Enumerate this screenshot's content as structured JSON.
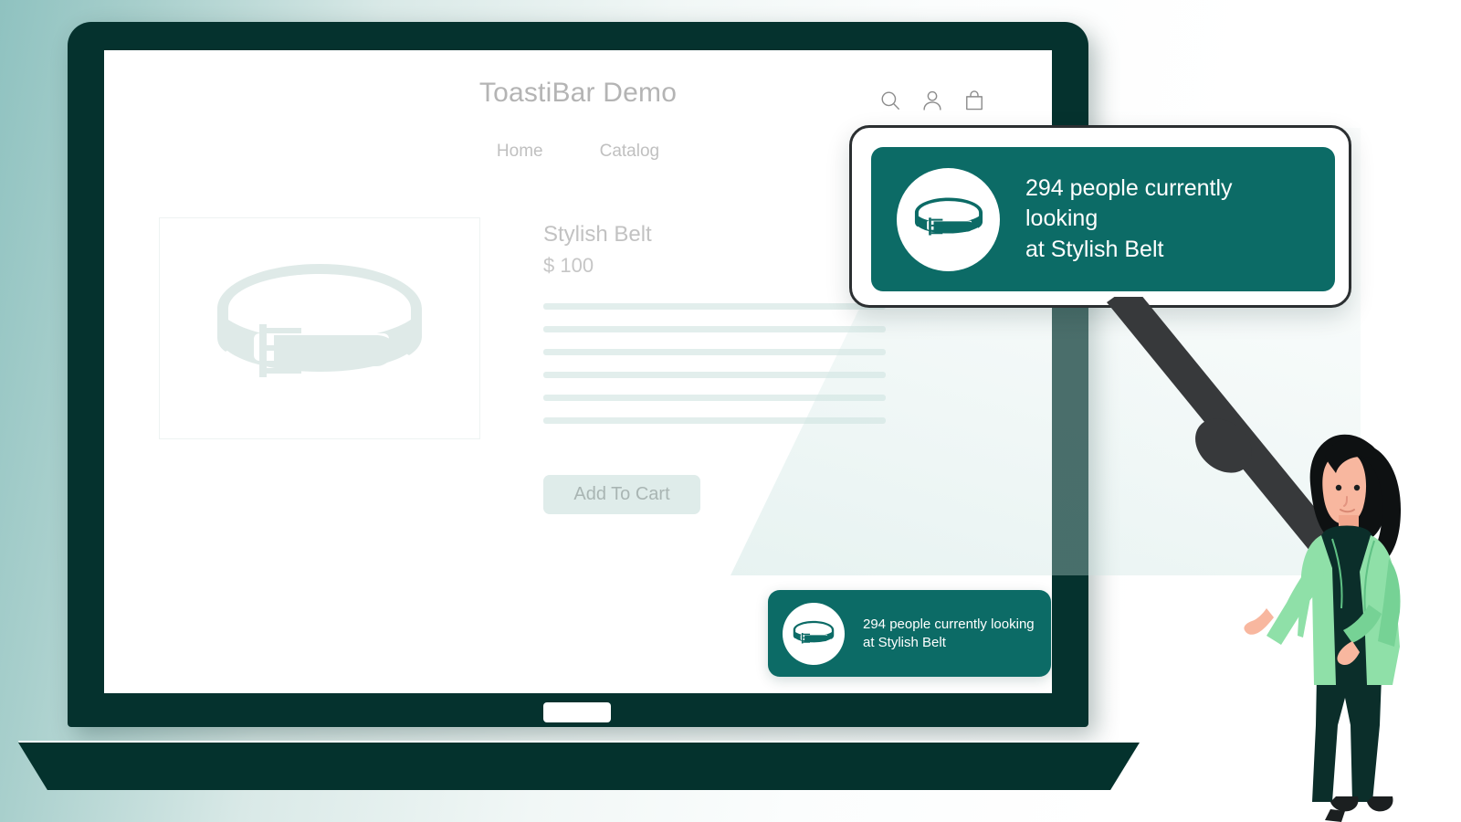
{
  "site": {
    "brand_title": "ToastiBar Demo",
    "nav": [
      {
        "label": "Home"
      },
      {
        "label": "Catalog"
      }
    ],
    "header_icons": [
      {
        "name": "search-icon"
      },
      {
        "name": "account-icon"
      },
      {
        "name": "shopping-bag-icon"
      }
    ]
  },
  "product": {
    "title": "Stylish Belt",
    "price": "$ 100",
    "add_to_cart_label": "Add To Cart",
    "image_alt": "belt-illustration",
    "skeleton_line_count": 6
  },
  "toast": {
    "line1": "294 people currently looking",
    "line2": "at Stylish Belt",
    "full_text": "294 people currently looking at Stylish Belt",
    "count": 294,
    "product_name": "Stylish Belt",
    "thumb_alt": "belt-thumbnail"
  },
  "colors": {
    "brand_teal": "#0c6b66",
    "laptop_bezel": "#05322e",
    "background_teal": "#8fc2c0",
    "skeleton": "#e2eeec",
    "button_bg": "#dfecea",
    "button_text": "#a9b5b3",
    "muted_text": "#c2c2c2",
    "jacket_green": "#8fe0a8",
    "outfit_dark": "#0b2e2a",
    "skin": "#f8b79f",
    "handle_dark": "#37393b"
  }
}
